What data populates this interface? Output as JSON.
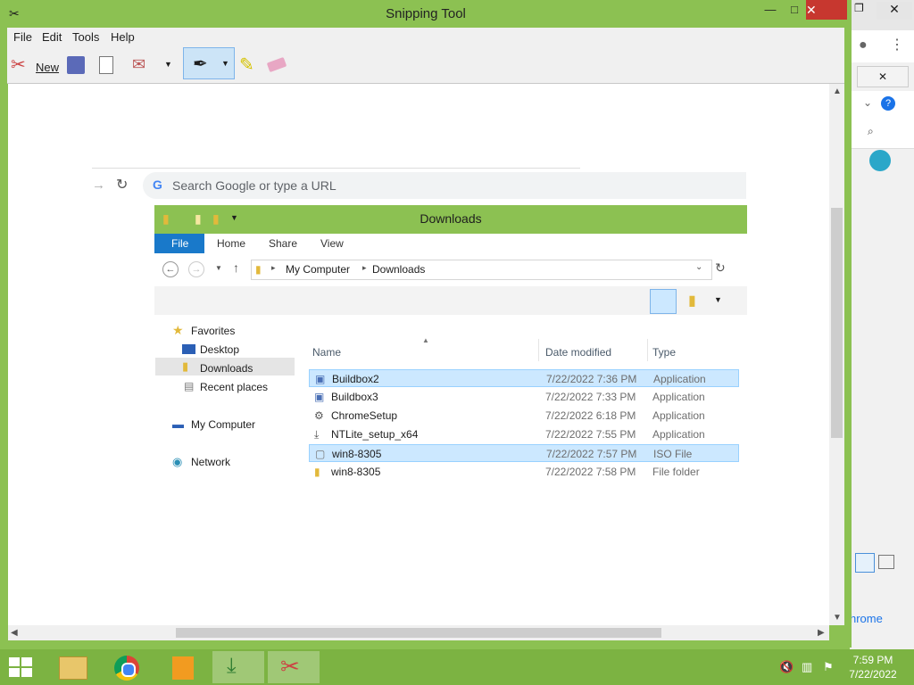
{
  "window": {
    "title": "Snipping Tool",
    "minimize": "—",
    "maximize": "□",
    "close": "✕"
  },
  "menu": [
    "File",
    "Edit",
    "Tools",
    "Help"
  ],
  "toolbar": {
    "new_label": "New"
  },
  "snip": {
    "omnibox_placeholder": "Search Google or type a URL",
    "explorer": {
      "title": "Downloads",
      "ribbon_tabs": [
        "File",
        "Home",
        "Share",
        "View"
      ],
      "breadcrumb": [
        "My Computer",
        "Downloads"
      ],
      "nav": {
        "favorites": "Favorites",
        "desktop": "Desktop",
        "downloads": "Downloads",
        "recent": "Recent places",
        "computer": "My Computer",
        "network": "Network"
      },
      "columns": {
        "name": "Name",
        "date": "Date modified",
        "type": "Type"
      },
      "files": [
        {
          "name": "Buildbox2",
          "date": "7/22/2022 7:36 PM",
          "type": "Application",
          "selected": true
        },
        {
          "name": "Buildbox3",
          "date": "7/22/2022 7:33 PM",
          "type": "Application",
          "selected": false
        },
        {
          "name": "ChromeSetup",
          "date": "7/22/2022 6:18 PM",
          "type": "Application",
          "selected": false
        },
        {
          "name": "NTLite_setup_x64",
          "date": "7/22/2022 7:55 PM",
          "type": "Application",
          "selected": false
        },
        {
          "name": "win8-8305",
          "date": "7/22/2022 7:57 PM",
          "type": "ISO File",
          "selected": true
        },
        {
          "name": "win8-8305",
          "date": "7/22/2022 7:58 PM",
          "type": "File folder",
          "selected": false
        }
      ]
    }
  },
  "background_window": {
    "partial_text": "hrome"
  },
  "taskbar": {
    "time": "7:59 PM",
    "date": "7/22/2022"
  },
  "colors": {
    "accent": "#8cc152",
    "taskbar": "#7cb342",
    "close": "#c7372f",
    "selection": "#cce8ff"
  }
}
